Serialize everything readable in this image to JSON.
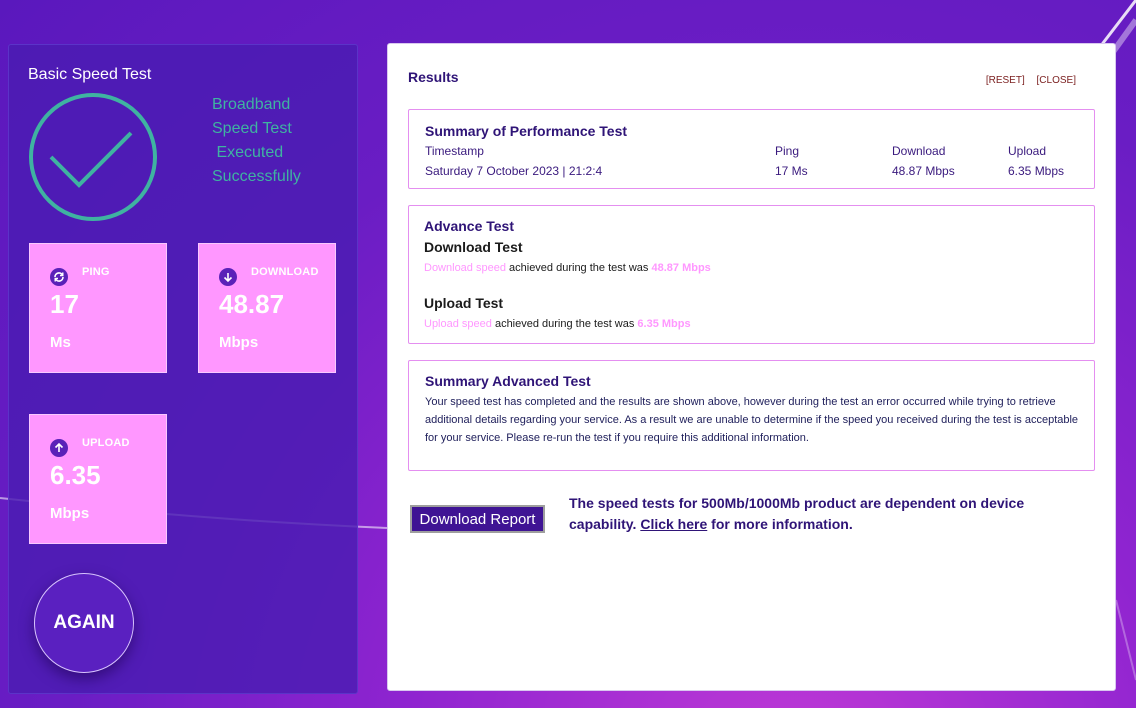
{
  "left": {
    "title": "Basic Speed Test",
    "status_lines": [
      "Broadband",
      "Speed Test",
      " Executed",
      "Successfully"
    ],
    "tiles": [
      {
        "label": "PING",
        "value": "17",
        "unit": "Ms",
        "icon": "refresh-icon"
      },
      {
        "label": "DOWNLOAD",
        "value": "48.87",
        "unit": "Mbps",
        "icon": "arrow-down-icon"
      },
      {
        "label": "UPLOAD",
        "value": "6.35",
        "unit": "Mbps",
        "icon": "arrow-up-icon"
      }
    ],
    "again_label": "AGAIN"
  },
  "results": {
    "title": "Results",
    "reset_label": "[RESET]",
    "close_label": "[CLOSE]",
    "summary": {
      "title": "Summary of Performance Test",
      "headers": {
        "timestamp": "Timestamp",
        "ping": "Ping",
        "download": "Download",
        "upload": "Upload"
      },
      "values": {
        "timestamp": "Saturday 7 October 2023 | 21:2:4",
        "ping": "17 Ms",
        "download": "48.87 Mbps",
        "upload": "6.35 Mbps"
      }
    },
    "advance": {
      "title": "Advance Test",
      "download_title": "Download Test",
      "download_prefix": "Download speed",
      "download_mid": " achieved during the test was ",
      "download_value": "48.87 Mbps",
      "upload_title": "Upload Test",
      "upload_prefix": "Upload speed",
      "upload_mid": " achieved during the test was ",
      "upload_value": "6.35 Mbps"
    },
    "summary_advanced": {
      "title": "Summary Advanced Test",
      "text": "Your speed test has completed and the results are shown above, however during the test an error occurred while trying to retrieve additional details regarding your service. As a result we are unable to determine if the speed you received during the test is acceptable for your service. Please re-run the test if you require this additional information."
    },
    "download_report_label": "Download Report",
    "note_before": "The speed tests for 500Mb/1000Mb product are dependent on device capability. ",
    "note_link": "Click here",
    "note_after": " for more information."
  },
  "colors": {
    "accent": "#ff97ff",
    "panel": "#4a1cb2",
    "check": "#3fb3a1",
    "heading": "#2f1477"
  }
}
